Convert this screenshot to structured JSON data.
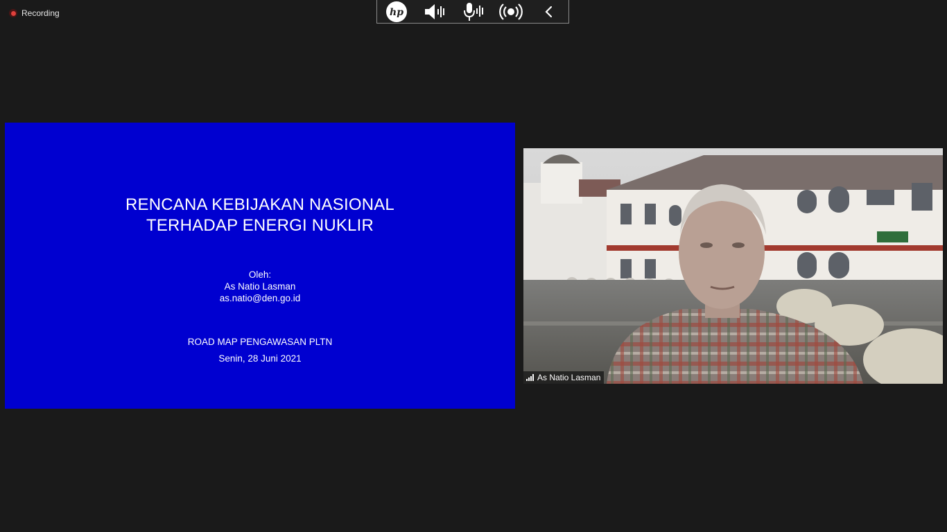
{
  "recording": {
    "label": "Recording",
    "dot_color": "#e0403c"
  },
  "toolbar": {
    "icons": [
      "hp-logo-icon",
      "speaker-icon",
      "microphone-icon",
      "broadcast-icon",
      "chevron-left-icon"
    ]
  },
  "slide": {
    "background": "#0000d0",
    "title_line1": "RENCANA KEBIJAKAN NASIONAL",
    "title_line2": "TERHADAP ENERGI NUKLIR",
    "by_label": "Oleh:",
    "presenter": "As Natio Lasman",
    "email": "as.natio@den.go.id",
    "event": "ROAD MAP PENGAWASAN PLTN",
    "date": "Senin, 28 Juni 2021"
  },
  "video": {
    "participant_name": "As Natio Lasman"
  }
}
